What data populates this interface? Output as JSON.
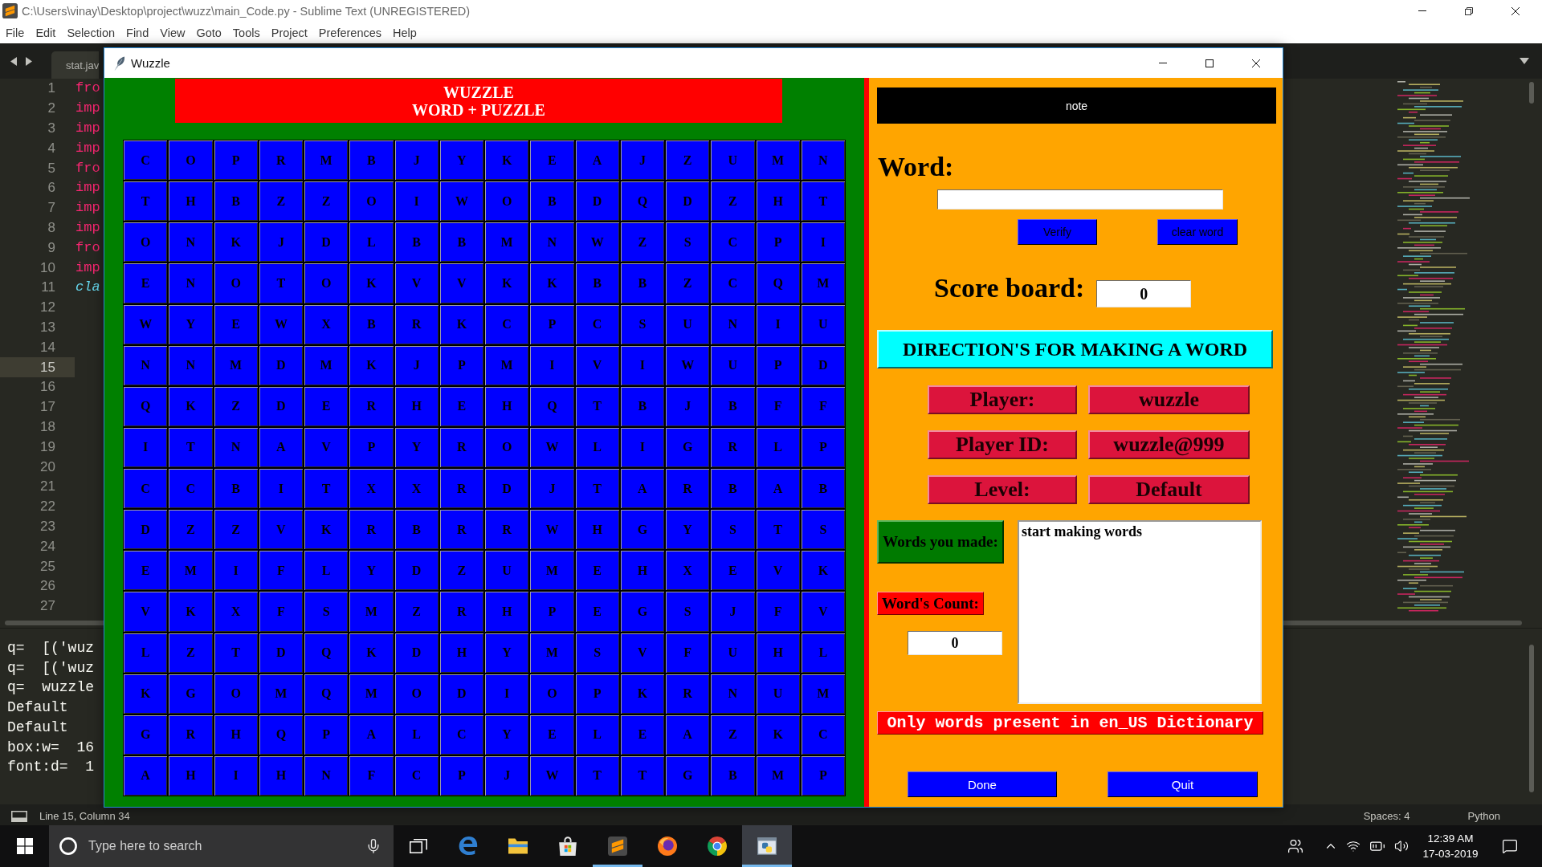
{
  "editor": {
    "title": "C:\\Users\\vinay\\Desktop\\project\\wuzz\\main_Code.py - Sublime Text (UNREGISTERED)",
    "menu": [
      "File",
      "Edit",
      "Selection",
      "Find",
      "View",
      "Goto",
      "Tools",
      "Project",
      "Preferences",
      "Help"
    ],
    "tabs": [
      {
        "label": "stat.jav",
        "selected": false
      }
    ],
    "lines": [
      {
        "number": "1",
        "current": false,
        "code": {
          "text": "fro",
          "kind": "keyword"
        }
      },
      {
        "number": "2",
        "current": false,
        "code": {
          "text": "imp",
          "kind": "keyword"
        }
      },
      {
        "number": "3",
        "current": false,
        "code": {
          "text": "imp",
          "kind": "keyword"
        }
      },
      {
        "number": "4",
        "current": false,
        "code": {
          "text": "imp",
          "kind": "keyword"
        }
      },
      {
        "number": "5",
        "current": false,
        "code": {
          "text": "fro",
          "kind": "keyword"
        }
      },
      {
        "number": "6",
        "current": false,
        "code": {
          "text": "imp",
          "kind": "keyword"
        }
      },
      {
        "number": "7",
        "current": false,
        "code": {
          "text": "imp",
          "kind": "keyword"
        }
      },
      {
        "number": "8",
        "current": false,
        "code": {
          "text": "imp",
          "kind": "keyword"
        }
      },
      {
        "number": "9",
        "current": false,
        "code": {
          "text": "fro",
          "kind": "keyword"
        }
      },
      {
        "number": "10",
        "current": false,
        "code": {
          "text": "imp",
          "kind": "keyword"
        }
      },
      {
        "number": "11",
        "current": false,
        "code": {
          "text": "cla",
          "kind": "storage"
        }
      },
      {
        "number": "12",
        "current": false
      },
      {
        "number": "13",
        "current": false
      },
      {
        "number": "14",
        "current": false
      },
      {
        "number": "15",
        "current": true
      },
      {
        "number": "16",
        "current": false
      },
      {
        "number": "17",
        "current": false
      },
      {
        "number": "18",
        "current": false
      },
      {
        "number": "19",
        "current": false
      },
      {
        "number": "20",
        "current": false
      },
      {
        "number": "21",
        "current": false
      },
      {
        "number": "22",
        "current": false
      },
      {
        "number": "23",
        "current": false
      },
      {
        "number": "24",
        "current": false
      },
      {
        "number": "25",
        "current": false
      },
      {
        "number": "26",
        "current": false
      },
      {
        "number": "27",
        "current": false
      }
    ],
    "console": [
      "q=  [('wuz",
      "q=  [('wuz",
      "q=  wuzzle",
      "Default",
      "Default",
      "box:w=  16",
      "font:d=  1"
    ],
    "status_bar": {
      "position": "Line 15, Column 34",
      "indentation": "Spaces: 4",
      "syntax": "Python"
    }
  },
  "game": {
    "title": "Wuzzle",
    "banner": [
      "WUZZLE",
      "WORD + PUZZLE"
    ],
    "grid": [
      [
        "C",
        "O",
        "P",
        "R",
        "M",
        "B",
        "J",
        "Y",
        "K",
        "E",
        "A",
        "J",
        "Z",
        "U",
        "M",
        "N"
      ],
      [
        "T",
        "H",
        "B",
        "Z",
        "Z",
        "O",
        "I",
        "W",
        "O",
        "B",
        "D",
        "Q",
        "D",
        "Z",
        "H",
        "T"
      ],
      [
        "O",
        "N",
        "K",
        "J",
        "D",
        "L",
        "B",
        "B",
        "M",
        "N",
        "W",
        "Z",
        "S",
        "C",
        "P",
        "I"
      ],
      [
        "E",
        "N",
        "O",
        "T",
        "O",
        "K",
        "V",
        "V",
        "K",
        "K",
        "B",
        "B",
        "Z",
        "C",
        "Q",
        "M"
      ],
      [
        "W",
        "Y",
        "E",
        "W",
        "X",
        "B",
        "R",
        "K",
        "C",
        "P",
        "C",
        "S",
        "U",
        "N",
        "I",
        "U"
      ],
      [
        "N",
        "N",
        "M",
        "D",
        "M",
        "K",
        "J",
        "P",
        "M",
        "I",
        "V",
        "I",
        "W",
        "U",
        "P",
        "D"
      ],
      [
        "Q",
        "K",
        "Z",
        "D",
        "E",
        "R",
        "H",
        "E",
        "H",
        "Q",
        "T",
        "B",
        "J",
        "B",
        "F",
        "F"
      ],
      [
        "I",
        "T",
        "N",
        "A",
        "V",
        "P",
        "Y",
        "R",
        "O",
        "W",
        "L",
        "I",
        "G",
        "R",
        "L",
        "P"
      ],
      [
        "C",
        "C",
        "B",
        "I",
        "T",
        "X",
        "X",
        "R",
        "D",
        "J",
        "T",
        "A",
        "R",
        "B",
        "A",
        "B"
      ],
      [
        "D",
        "Z",
        "Z",
        "V",
        "K",
        "R",
        "B",
        "R",
        "R",
        "W",
        "H",
        "G",
        "Y",
        "S",
        "T",
        "S"
      ],
      [
        "E",
        "M",
        "I",
        "F",
        "L",
        "Y",
        "D",
        "Z",
        "U",
        "M",
        "E",
        "H",
        "X",
        "E",
        "V",
        "K"
      ],
      [
        "V",
        "K",
        "X",
        "F",
        "S",
        "M",
        "Z",
        "R",
        "H",
        "P",
        "E",
        "G",
        "S",
        "J",
        "F",
        "V"
      ],
      [
        "L",
        "Z",
        "T",
        "D",
        "Q",
        "K",
        "D",
        "H",
        "Y",
        "M",
        "S",
        "V",
        "F",
        "U",
        "H",
        "L"
      ],
      [
        "K",
        "G",
        "O",
        "M",
        "Q",
        "M",
        "O",
        "D",
        "I",
        "O",
        "P",
        "K",
        "R",
        "N",
        "U",
        "M"
      ],
      [
        "G",
        "R",
        "H",
        "Q",
        "P",
        "A",
        "L",
        "C",
        "Y",
        "E",
        "L",
        "E",
        "A",
        "Z",
        "K",
        "C"
      ],
      [
        "A",
        "H",
        "I",
        "H",
        "N",
        "F",
        "C",
        "P",
        "J",
        "W",
        "T",
        "T",
        "G",
        "B",
        "M",
        "P"
      ]
    ],
    "note": "note",
    "word_label": "Word:",
    "word_buttons": [
      "Verify",
      "clear word"
    ],
    "score": {
      "label": "Score board:",
      "value": "0"
    },
    "directions": "DIRECTION'S FOR MAKING A WORD",
    "info": [
      {
        "label": "Player:",
        "value": "wuzzle"
      },
      {
        "label": "Player ID:",
        "value": "wuzzle@999"
      },
      {
        "label": "Level:",
        "value": "Default"
      }
    ],
    "words_made": {
      "label": "Words you made:",
      "text": "start making words"
    },
    "count": {
      "label": "Word's Count:",
      "value": "0"
    },
    "dictionary_note": "Only words present in en_US Dictionary",
    "actions": [
      "Done",
      "Quit"
    ]
  },
  "taskbar": {
    "search": {
      "placeholder": "Type here to search"
    },
    "apps": [
      {
        "kind": "edge",
        "running": false,
        "selected": false
      },
      {
        "kind": "explorer",
        "running": false,
        "selected": false
      },
      {
        "kind": "store",
        "running": false,
        "selected": false
      },
      {
        "kind": "sublime",
        "running": true,
        "selected": false
      },
      {
        "kind": "firefox",
        "running": false,
        "selected": false
      },
      {
        "kind": "chrome",
        "running": false,
        "selected": false
      },
      {
        "kind": "python",
        "running": true,
        "selected": true
      }
    ],
    "clock": {
      "time": "12:39 AM",
      "date": "17-03-2019"
    }
  }
}
